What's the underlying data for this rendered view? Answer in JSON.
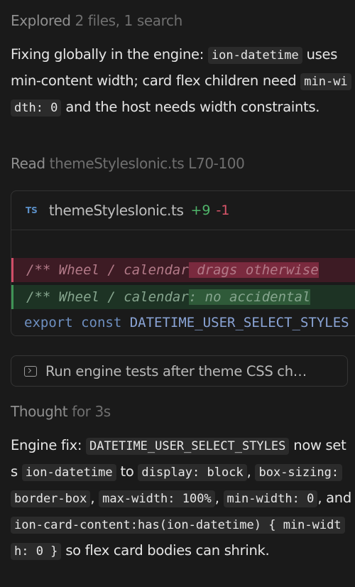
{
  "explored": {
    "label": "Explored",
    "detail": "2 files, 1 search"
  },
  "message1": {
    "t1": "Fixing globally in the engine: ",
    "c1": "ion-datetime",
    "t2": " uses min-content width; card flex children need ",
    "c2": "min-width: 0",
    "t3": " and the host needs width constraints."
  },
  "read": {
    "label": "Read",
    "file": "themeStylesIonic.ts",
    "range": "L70-100"
  },
  "diff": {
    "lang_badge": "TS",
    "filename": "themeStylesIonic.ts",
    "additions": "+9",
    "deletions": "-1",
    "removed_line_prefix": "/** Wheel / calendar",
    "removed_line_highlight": " drags otherwise",
    "added_line_prefix": "/** Wheel / calendar",
    "added_line_highlight": ": no accidental",
    "context_keyword": "export const",
    "context_identifier": "DATETIME_USER_SELECT_STYLES"
  },
  "task": {
    "icon": "terminal-icon",
    "label": "Run engine tests after theme CSS ch…"
  },
  "thought": {
    "label": "Thought",
    "duration": "for 3s"
  },
  "message2": {
    "t1": "Engine fix: ",
    "c1": "DATETIME_USER_SELECT_STYLES",
    "t2": " now sets ",
    "c2": "ion-datetime",
    "t3": " to ",
    "c3": "display: block",
    "t4": ", ",
    "c4": "box-sizing: border-box",
    "t5": ", ",
    "c5": "max-width: 100%",
    "t6": ", ",
    "c6": "min-width: 0",
    "t7": ", and ",
    "c7": "ion-card-content:has(ion-datetime) { min-width: 0 }",
    "t8": " so flex card bodies can shrink."
  }
}
